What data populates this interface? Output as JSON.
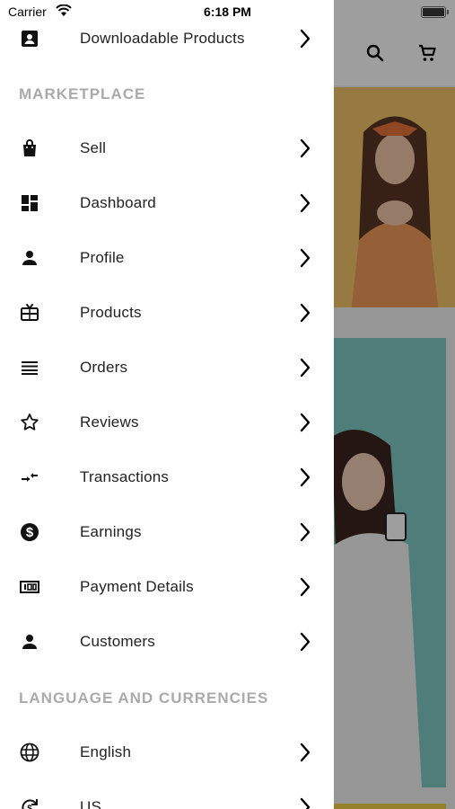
{
  "status_bar": {
    "carrier": "Carrier",
    "time": "6:18 PM"
  },
  "drawer": {
    "items_top": [
      {
        "label": "Downloadable Products",
        "icon": "account-box-icon"
      }
    ],
    "sections": [
      {
        "title": "MARKETPLACE",
        "items": [
          {
            "label": "Sell",
            "icon": "shopping-bag-icon"
          },
          {
            "label": "Dashboard",
            "icon": "dashboard-icon"
          },
          {
            "label": "Profile",
            "icon": "person-icon"
          },
          {
            "label": "Products",
            "icon": "redeem-icon"
          },
          {
            "label": "Orders",
            "icon": "list-lines-icon"
          },
          {
            "label": "Reviews",
            "icon": "star-outline-icon"
          },
          {
            "label": "Transactions",
            "icon": "swap-horiz-icon"
          },
          {
            "label": "Earnings",
            "icon": "dollar-circle-icon"
          },
          {
            "label": "Payment Details",
            "icon": "money-icon"
          },
          {
            "label": "Customers",
            "icon": "person-icon"
          }
        ]
      },
      {
        "title": "LANGUAGE AND CURRENCIES",
        "items": [
          {
            "label": "English",
            "icon": "globe-icon"
          },
          {
            "label": "US",
            "icon": "currency-exchange-icon"
          }
        ]
      }
    ]
  },
  "background": {
    "toolbar_icons": [
      "search-icon",
      "cart-icon"
    ]
  }
}
